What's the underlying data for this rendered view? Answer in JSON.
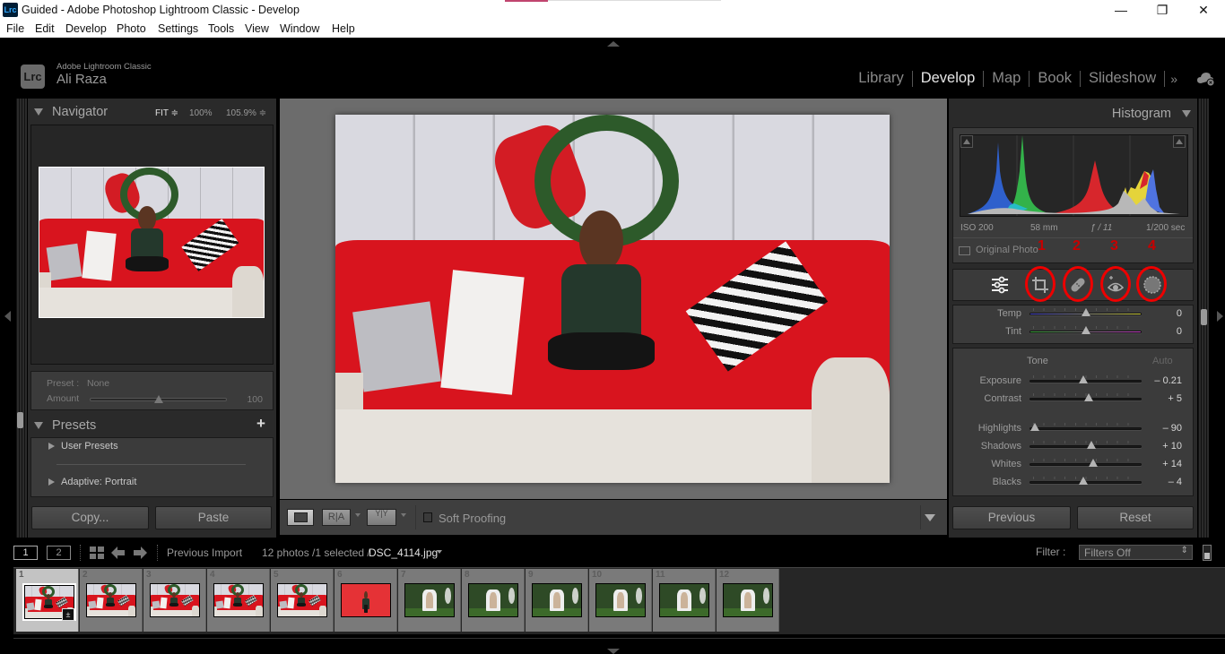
{
  "window": {
    "app_icon": "Lrc",
    "title": "Guided - Adobe Photoshop Lightroom Classic - Develop",
    "controls": {
      "minimize": "—",
      "restore": "❐",
      "close": "✕"
    }
  },
  "menu": [
    "File",
    "Edit",
    "Develop",
    "Photo",
    "Settings",
    "Tools",
    "View",
    "Window",
    "Help"
  ],
  "identity": {
    "badge": "Lrc",
    "product": "Adobe Lightroom Classic",
    "user": "Ali Raza"
  },
  "modules": {
    "items": [
      "Library",
      "Develop",
      "Map",
      "Book",
      "Slideshow"
    ],
    "active": "Develop",
    "more_icon": "»",
    "cloud_icon": "cloud-sync-icon"
  },
  "navigator": {
    "title": "Navigator",
    "zoom_options": [
      "FIT ≑",
      "100%",
      "105.9% ≑"
    ],
    "selected_zoom": "FIT"
  },
  "preset_amount": {
    "preset_label": "Preset :",
    "preset_value": "None",
    "amount_label": "Amount",
    "amount_value": "100",
    "amount_fraction": 0.5
  },
  "presets": {
    "title": "Presets",
    "add_icon": "+",
    "items": [
      "User Presets",
      "Adaptive: Portrait"
    ]
  },
  "left_buttons": {
    "copy": "Copy...",
    "paste": "Paste"
  },
  "histogram": {
    "title": "Histogram",
    "exif": {
      "iso": "ISO 200",
      "focal": "58 mm",
      "aperture": "ƒ / 11",
      "shutter": "1/200 sec"
    },
    "original_photo_label": "Original Photo"
  },
  "tools": {
    "items": [
      {
        "name": "edit-sliders",
        "annotation": ""
      },
      {
        "name": "crop",
        "annotation": "1"
      },
      {
        "name": "healing",
        "annotation": "2"
      },
      {
        "name": "red-eye",
        "annotation": "3"
      },
      {
        "name": "masking",
        "annotation": "4"
      }
    ],
    "annotation_color": "#e00000"
  },
  "basic": {
    "wb": [
      {
        "label": "Temp",
        "value": "0",
        "fraction": 0.5
      },
      {
        "label": "Tint",
        "value": "0",
        "fraction": 0.5
      }
    ],
    "tone_label": "Tone",
    "auto_label": "Auto",
    "tone": [
      {
        "label": "Exposure",
        "value": "– 0.21",
        "fraction": 0.48
      },
      {
        "label": "Contrast",
        "value": "+ 5",
        "fraction": 0.525
      }
    ],
    "presence": [
      {
        "label": "Highlights",
        "value": "– 90",
        "fraction": 0.05
      },
      {
        "label": "Shadows",
        "value": "+ 10",
        "fraction": 0.55
      },
      {
        "label": "Whites",
        "value": "+ 14",
        "fraction": 0.57
      },
      {
        "label": "Blacks",
        "value": "– 4",
        "fraction": 0.48
      }
    ]
  },
  "right_buttons": {
    "previous": "Previous",
    "reset": "Reset"
  },
  "toolbar": {
    "view_loupe_icon": "loupe-view-icon",
    "before_after_label": "R|A",
    "before_after_split": "Y|Y",
    "soft_proofing": "Soft Proofing",
    "soft_proofing_checked": false
  },
  "filmstrip": {
    "view1": "1",
    "view2": "2",
    "source": "Previous Import",
    "count": "12 photos /1 selected /",
    "filename": "DSC_4114.jpg",
    "filter_label": "Filter :",
    "filter_value": "Filters Off",
    "thumbnails": [
      {
        "num": "1",
        "type": "sofa",
        "selected": true
      },
      {
        "num": "2",
        "type": "sofa",
        "selected": false
      },
      {
        "num": "3",
        "type": "sofa",
        "selected": false
      },
      {
        "num": "4",
        "type": "sofa",
        "selected": false
      },
      {
        "num": "5",
        "type": "sofa",
        "selected": false
      },
      {
        "num": "6",
        "type": "red",
        "selected": false
      },
      {
        "num": "7",
        "type": "garden",
        "selected": false
      },
      {
        "num": "8",
        "type": "garden",
        "selected": false
      },
      {
        "num": "9",
        "type": "garden",
        "selected": false
      },
      {
        "num": "10",
        "type": "garden",
        "selected": false
      },
      {
        "num": "11",
        "type": "garden",
        "selected": false
      },
      {
        "num": "12",
        "type": "garden",
        "selected": false
      }
    ]
  }
}
